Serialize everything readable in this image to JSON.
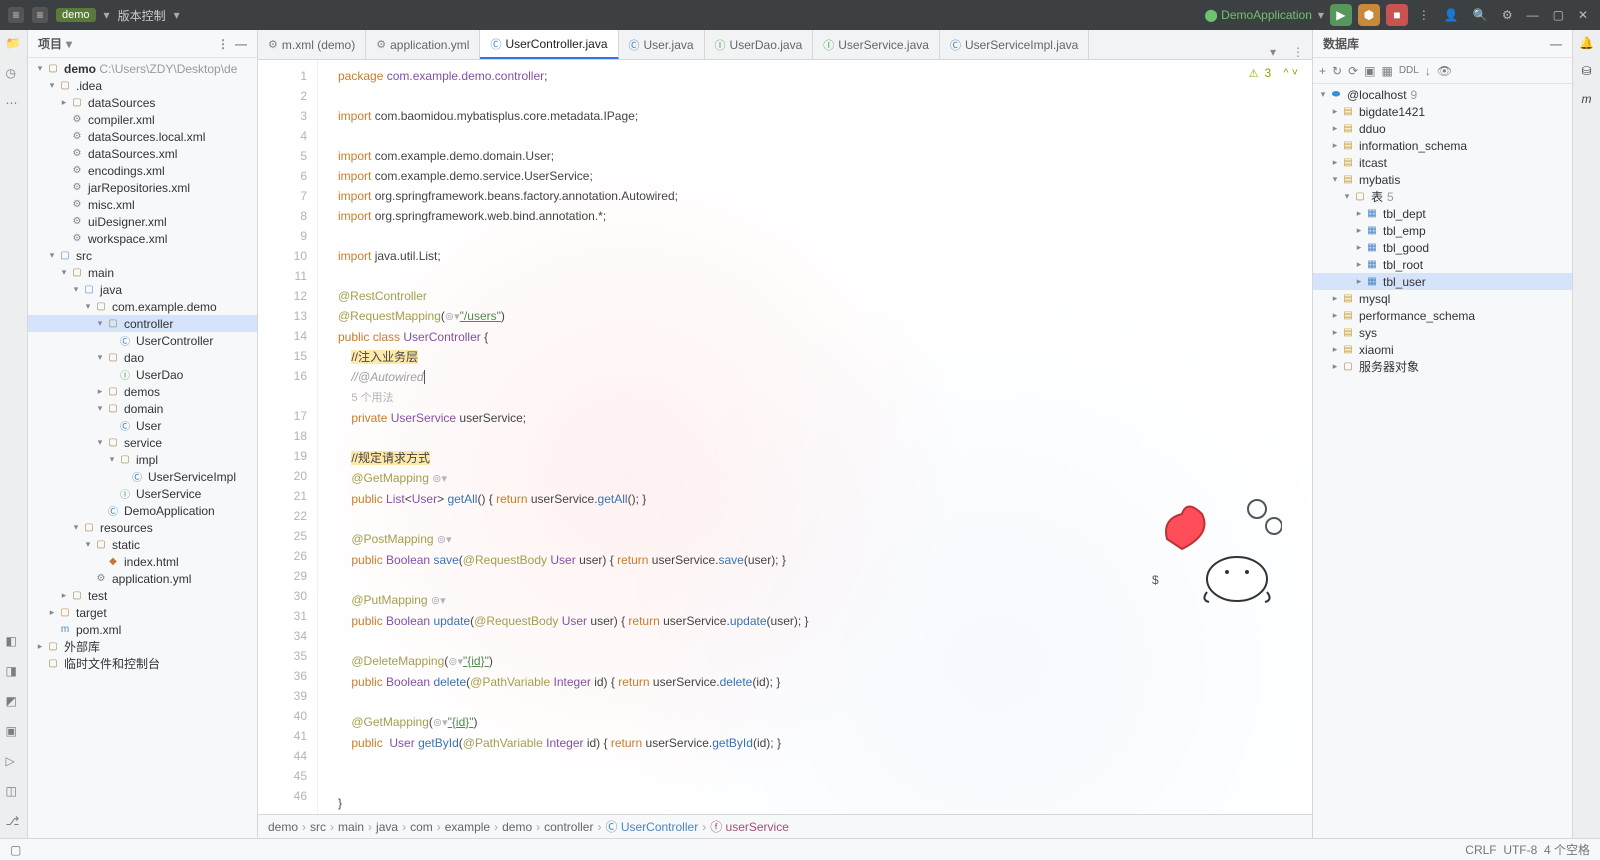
{
  "titlebar": {
    "project": "demo",
    "vcs": "版本控制",
    "runConfig": "DemoApplication"
  },
  "projectPanel": {
    "title": "项目"
  },
  "projectTree": {
    "root": "demo",
    "rootPath": "C:\\Users\\ZDY\\Desktop\\de",
    "idea": ".idea",
    "ideaChildren": [
      "dataSources",
      "compiler.xml",
      "dataSources.local.xml",
      "dataSources.xml",
      "encodings.xml",
      "jarRepositories.xml",
      "misc.xml",
      "uiDesigner.xml",
      "workspace.xml"
    ],
    "src": "src",
    "main": "main",
    "java": "java",
    "pkg": "com.example.demo",
    "controller": "controller",
    "userController": "UserController",
    "dao": "dao",
    "userDao": "UserDao",
    "demos": "demos",
    "domain": "domain",
    "user": "User",
    "service": "service",
    "impl": "impl",
    "userServiceImpl": "UserServiceImpl",
    "userService": "UserService",
    "demoApp": "DemoApplication",
    "resources": "resources",
    "static": "static",
    "indexHtml": "index.html",
    "appYml": "application.yml",
    "test": "test",
    "target": "target",
    "pom": "pom.xml",
    "extLib": "外部库",
    "scratch": "临时文件和控制台"
  },
  "tabs": [
    {
      "label": "m.xml (demo)",
      "icon": "cfg",
      "active": false
    },
    {
      "label": "application.yml",
      "icon": "cfg",
      "active": false
    },
    {
      "label": "UserController.java",
      "icon": "cls",
      "active": true
    },
    {
      "label": "User.java",
      "icon": "cls",
      "active": false
    },
    {
      "label": "UserDao.java",
      "icon": "int",
      "active": false
    },
    {
      "label": "UserService.java",
      "icon": "int",
      "active": false
    },
    {
      "label": "UserServiceImpl.java",
      "icon": "cls",
      "active": false
    }
  ],
  "inspection": {
    "warn": "3"
  },
  "code": {
    "pkg": "package",
    "pkgName": "com.example.demo.controller",
    "imp": "import",
    "imp1": "com.baomidou.mybatisplus.core.metadata.IPage",
    "imp2": "com.example.demo.domain.User",
    "imp3": "com.example.demo.service.UserService",
    "imp4": "org.springframework.beans.factory.annotation.Autowired",
    "imp5": "org.springframework.web.bind.annotation.*",
    "imp6": "java.util.List",
    "rest": "@RestController",
    "reqMap": "@RequestMapping",
    "users": "\"/users\"",
    "pub": "public",
    "clazz": "class",
    "ctrlName": "UserController",
    "cmt1": "//注入业务层",
    "cmt2": "//@Autowired",
    "usages": "5 个用法",
    "priv": "private",
    "usvc": "UserService",
    "usvcVar": "userService",
    "cmt3": "//规定请求方式",
    "get": "@GetMapping",
    "post": "@PostMapping",
    "put": "@PutMapping",
    "del": "@DeleteMapping",
    "list": "List",
    "userT": "User",
    "getAll": "getAll",
    "ret": "return",
    "bool": "Boolean",
    "save": "save",
    "reqBody": "@RequestBody",
    "userP": "user",
    "update": "update",
    "delete": "delete",
    "pathVar": "@PathVariable",
    "intT": "Integer",
    "idP": "id",
    "getById": "getById",
    "idPath": "\"{id}\""
  },
  "dbPanel": {
    "title": "数据库"
  },
  "db": {
    "root": "@localhost",
    "rootN": "9",
    "schemas": [
      "bigdate1421",
      "dduo",
      "information_schema",
      "itcast",
      "mybatis",
      "mysql",
      "performance_schema",
      "sys",
      "xiaomi"
    ],
    "tablesLabel": "表",
    "tablesN": "5",
    "tables": [
      "tbl_dept",
      "tbl_emp",
      "tbl_good",
      "tbl_root",
      "tbl_user"
    ],
    "serverObj": "服务器对象"
  },
  "crumbs": [
    "demo",
    "src",
    "main",
    "java",
    "com",
    "example",
    "demo",
    "controller",
    "UserController",
    "userService"
  ],
  "status": {
    "eol": "CRLF",
    "enc": "UTF-8",
    "spaces": "4 个空格"
  }
}
